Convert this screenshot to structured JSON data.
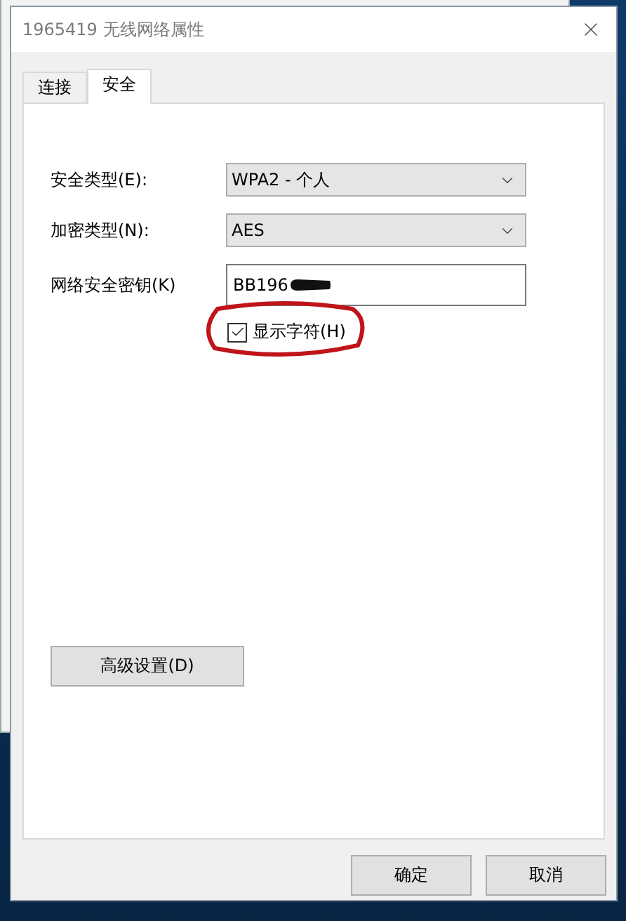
{
  "dialog": {
    "title": "1965419 无线网络属性"
  },
  "tabs": [
    {
      "label": "连接",
      "selected": false
    },
    {
      "label": "安全",
      "selected": true
    }
  ],
  "fields": [
    {
      "kind": "select",
      "label": "安全类型(E):",
      "value": "WPA2 - 个人"
    },
    {
      "kind": "select",
      "label": "加密类型(N):",
      "value": "AES"
    },
    {
      "kind": "text",
      "label": "网络安全密钥(K)",
      "value": "BB196",
      "redacted": true
    }
  ],
  "show_characters": {
    "label": "显示字符(H)",
    "checked": true,
    "circled": true
  },
  "advanced_button": "高级设置(D)",
  "buttons": [
    "确定",
    "取消"
  ]
}
